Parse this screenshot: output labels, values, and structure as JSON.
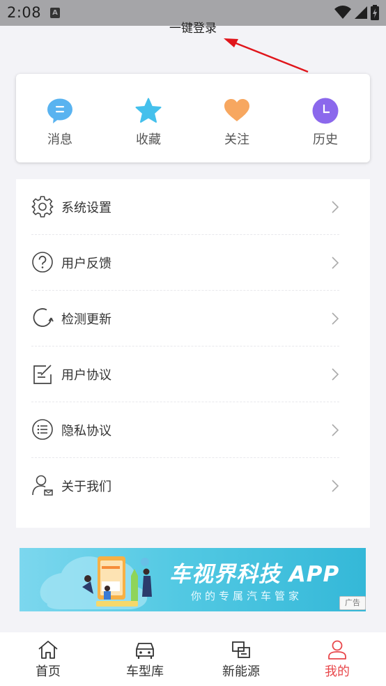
{
  "status_bar": {
    "time": "2:08",
    "notification_badge": "A"
  },
  "login": {
    "label": "一键登录"
  },
  "quick_actions": [
    {
      "label": "消息",
      "icon": "message-icon",
      "color": "#59b3f0"
    },
    {
      "label": "收藏",
      "icon": "star-icon",
      "color": "#44c0ec"
    },
    {
      "label": "关注",
      "icon": "heart-icon",
      "color": "#f7a760"
    },
    {
      "label": "历史",
      "icon": "clock-icon",
      "color": "#8b68ec"
    }
  ],
  "menu": [
    {
      "label": "系统设置",
      "icon": "gear-icon"
    },
    {
      "label": "用户反馈",
      "icon": "question-icon"
    },
    {
      "label": "检测更新",
      "icon": "refresh-icon"
    },
    {
      "label": "用户协议",
      "icon": "edit-document-icon"
    },
    {
      "label": "隐私协议",
      "icon": "list-icon"
    },
    {
      "label": "关于我们",
      "icon": "user-contact-icon"
    }
  ],
  "banner": {
    "title": "车视界科技 APP",
    "subtitle": "你的专属汽车管家",
    "ad_tag": "广告"
  },
  "tabbar": [
    {
      "label": "首页",
      "icon": "home-icon",
      "active": false
    },
    {
      "label": "车型库",
      "icon": "car-icon",
      "active": false
    },
    {
      "label": "新能源",
      "icon": "new-energy-icon",
      "active": false
    },
    {
      "label": "我的",
      "icon": "profile-icon",
      "active": true
    }
  ],
  "colors": {
    "accent_red": "#e8464a",
    "background": "#f3f3f7",
    "annotation_arrow": "#e0151b"
  }
}
